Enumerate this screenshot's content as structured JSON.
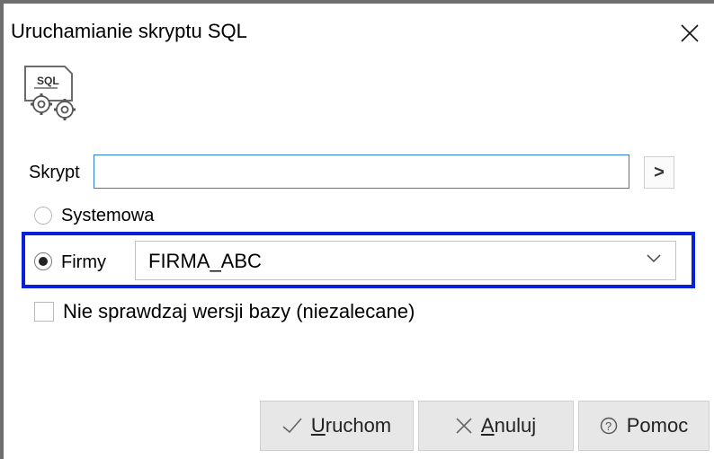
{
  "dialog": {
    "title": "Uruchamianie skryptu SQL",
    "icon_text": "SQL"
  },
  "script": {
    "label": "Skrypt",
    "value": "",
    "browse_glyph": ">"
  },
  "database": {
    "option_system_label": "Systemowa",
    "option_company_label": "Firmy",
    "selected_option": "Firmy",
    "company_value": "FIRMA_ABC"
  },
  "skip_version_check": {
    "label": "Nie sprawdzaj wersji bazy (niezalecane)",
    "checked": false
  },
  "buttons": {
    "run_mnemonic": "U",
    "run_rest": "ruchom",
    "cancel_mnemonic": "A",
    "cancel_rest": "nuluj",
    "help_label": "Pomoc"
  },
  "colors": {
    "highlight": "#0a1fd8",
    "input_focus_border": "#2f7bd6",
    "button_bg": "#e7e7e7"
  }
}
